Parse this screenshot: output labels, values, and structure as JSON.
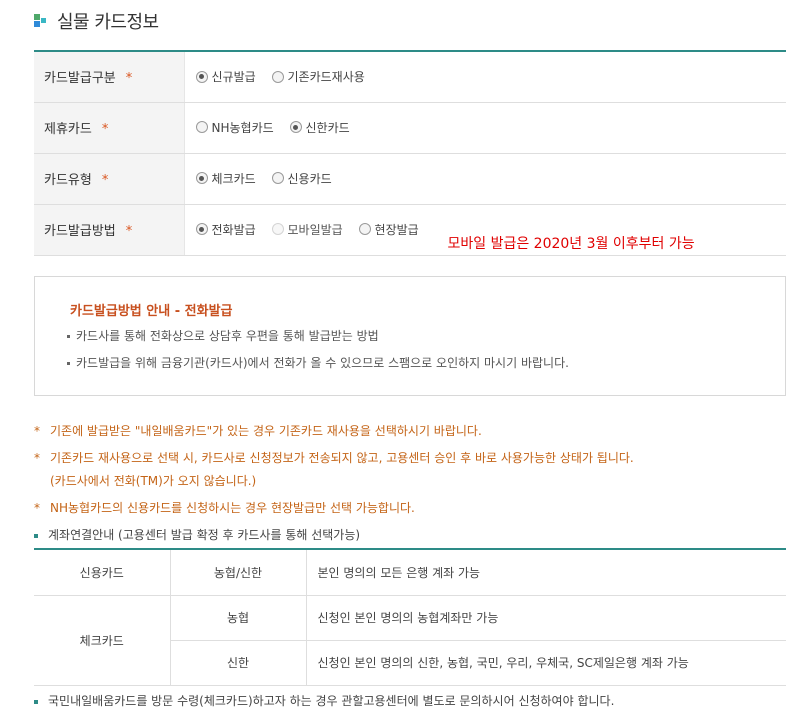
{
  "page_title": "실물 카드정보",
  "form_rows": [
    {
      "label": "카드발급구분",
      "required": "*",
      "options": [
        {
          "label": "신규발급",
          "checked": true,
          "disabled": false
        },
        {
          "label": "기존카드재사용",
          "checked": false,
          "disabled": false
        }
      ]
    },
    {
      "label": "제휴카드",
      "required": "*",
      "options": [
        {
          "label": "NH농협카드",
          "checked": false,
          "disabled": false
        },
        {
          "label": "신한카드",
          "checked": true,
          "disabled": false
        }
      ]
    },
    {
      "label": "카드유형",
      "required": "*",
      "options": [
        {
          "label": "체크카드",
          "checked": true,
          "disabled": false
        },
        {
          "label": "신용카드",
          "checked": false,
          "disabled": false
        }
      ]
    },
    {
      "label": "카드발급방법",
      "required": "*",
      "options": [
        {
          "label": "전화발급",
          "checked": true,
          "disabled": false
        },
        {
          "label": "모바일발급",
          "checked": false,
          "disabled": true
        },
        {
          "label": "현장발급",
          "checked": false,
          "disabled": false
        }
      ]
    }
  ],
  "mobile_note": "모바일 발급은 2020년 3월 이후부터 가능",
  "guide": {
    "title": "카드발급방법 안내 - 전화발급",
    "items": [
      "카드사를 통해 전화상으로 상담후 우편을 통해 발급받는 방법",
      "카드발급을 위해 금융기관(카드사)에서 전화가 올 수 있으므로 스팸으로 오인하지 마시기 바랍니다."
    ]
  },
  "notes": [
    "기존에 발급받은 \"내일배움카드\"가 있는 경우 기존카드 재사용을 선택하시기 바랍니다.",
    "기존카드 재사용으로 선택 시, 카드사로 신청정보가 전송되지 않고, 고용센터 승인 후 바로 사용가능한 상태가 됩니다.",
    "(카드사에서 전화(TM)가 오지 않습니다.)",
    "NH농협카드의 신용카드를 신청하시는 경우 현장발급만 선택 가능합니다."
  ],
  "note_star": "*",
  "account_title": "계좌연결안내 (고용센터 발급 확정 후 카드사를 통해 선택가능)",
  "account_table": {
    "credit": {
      "card": "신용카드",
      "bank": "농협/신한",
      "desc": "본인 명의의 모든 은행 계좌 가능"
    },
    "check": {
      "card": "체크카드",
      "rows": [
        {
          "bank": "농협",
          "desc": "신청인 본인 명의의 농협계좌만 가능"
        },
        {
          "bank": "신한",
          "desc": "신청인 본인 명의의 신한, 농협, 국민, 우리, 우체국, SC제일은행 계좌 가능"
        }
      ]
    }
  },
  "footer_note": "국민내일배움카드를 방문 수령(체크카드)하고자 하는 경우 관할고용센터에 별도로 문의하시어 신청하여야 합니다.",
  "colors": {
    "accent": "#2d8b87",
    "note": "#c46417",
    "mobile_note": "#e00000",
    "guide_title": "#c8501f"
  }
}
